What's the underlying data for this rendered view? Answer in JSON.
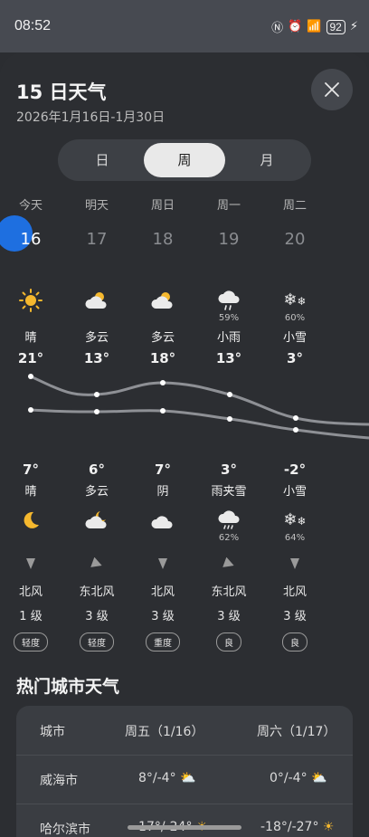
{
  "status_bar": {
    "time": "08:52",
    "battery": "92",
    "icons": [
      "nfc-icon",
      "alarm-icon",
      "wifi-icon",
      "signal-icon"
    ]
  },
  "header": {
    "title": "15 日天气",
    "date_range": "2026年1月16日-1月30日"
  },
  "segmented": {
    "tabs": [
      "日",
      "周",
      "月"
    ],
    "selected": "周"
  },
  "days": [
    {
      "dow": "今天",
      "date": "16",
      "day_cond": "晴",
      "day_temp": "21°",
      "night_temp": "7°",
      "night_cond": "晴",
      "day_icon": "sun-icon",
      "night_icon": "moon-icon",
      "day_pct": "",
      "night_pct": "",
      "wind_dir": "北风",
      "wind_level": "1 级",
      "aqi": "轻度"
    },
    {
      "dow": "明天",
      "date": "17",
      "day_cond": "多云",
      "day_temp": "13°",
      "night_temp": "6°",
      "night_cond": "多云",
      "day_icon": "partly-cloudy-icon",
      "night_icon": "moon-cloud-icon",
      "day_pct": "",
      "night_pct": "",
      "wind_dir": "东北风",
      "wind_level": "3 级",
      "aqi": "轻度"
    },
    {
      "dow": "周日",
      "date": "18",
      "day_cond": "多云",
      "day_temp": "18°",
      "night_temp": "7°",
      "night_cond": "阴",
      "day_icon": "partly-cloudy-icon",
      "night_icon": "cloud-icon",
      "day_pct": "",
      "night_pct": "",
      "wind_dir": "北风",
      "wind_level": "3 级",
      "aqi": "重度"
    },
    {
      "dow": "周一",
      "date": "19",
      "day_cond": "小雨",
      "day_temp": "13°",
      "night_temp": "3°",
      "night_cond": "雨夹雪",
      "day_icon": "rain-icon",
      "night_icon": "sleet-icon",
      "day_pct": "59%",
      "night_pct": "62%",
      "wind_dir": "东北风",
      "wind_level": "3 级",
      "aqi": "良"
    },
    {
      "dow": "周二",
      "date": "20",
      "day_cond": "小雪",
      "day_temp": "3°",
      "night_temp": "-2°",
      "night_cond": "小雪",
      "day_icon": "snow-icon",
      "night_icon": "snow-icon",
      "day_pct": "60%",
      "night_pct": "64%",
      "wind_dir": "北风",
      "wind_level": "3 级",
      "aqi": "良"
    }
  ],
  "hot_cities": {
    "title": "热门城市天气",
    "headers": [
      "城市",
      "周五（1/16）",
      "周六（1/17）"
    ],
    "rows": [
      {
        "city": "威海市",
        "d1": "8°/-4°",
        "d2": "0°/-4°"
      },
      {
        "city": "哈尔滨市",
        "d1": "-17°/-24°",
        "d2": "-18°/-27°"
      }
    ]
  },
  "colors": {
    "accent": "#1e6fe0",
    "sun": "#f5b82e",
    "background": "#2c2e32"
  }
}
